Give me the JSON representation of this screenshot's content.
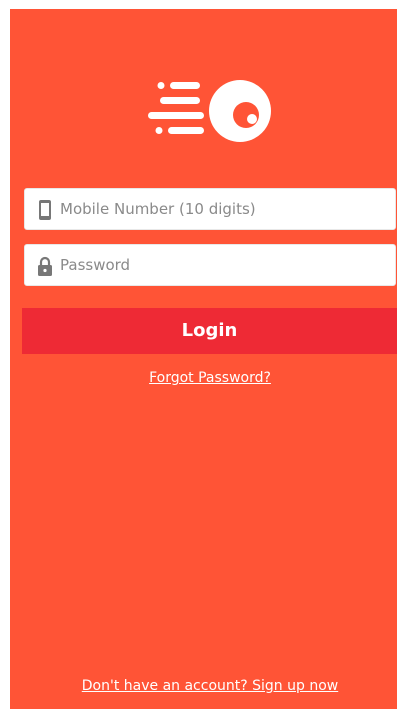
{
  "theme": {
    "background": "#ff5436",
    "button": "#ee2a35",
    "text_on_accent": "#ffffff"
  },
  "logo": {
    "icon": "speeding-ball-logo-icon"
  },
  "mobile_field": {
    "icon": "mobile-phone-icon",
    "placeholder": "Mobile Number (10 digits)",
    "value": ""
  },
  "password_field": {
    "icon": "lock-icon",
    "placeholder": "Password",
    "value": ""
  },
  "login_button": {
    "label": "Login"
  },
  "forgot_password": {
    "label": "Forgot Password?"
  },
  "signup": {
    "label": "Don't have an account? Sign up now"
  }
}
